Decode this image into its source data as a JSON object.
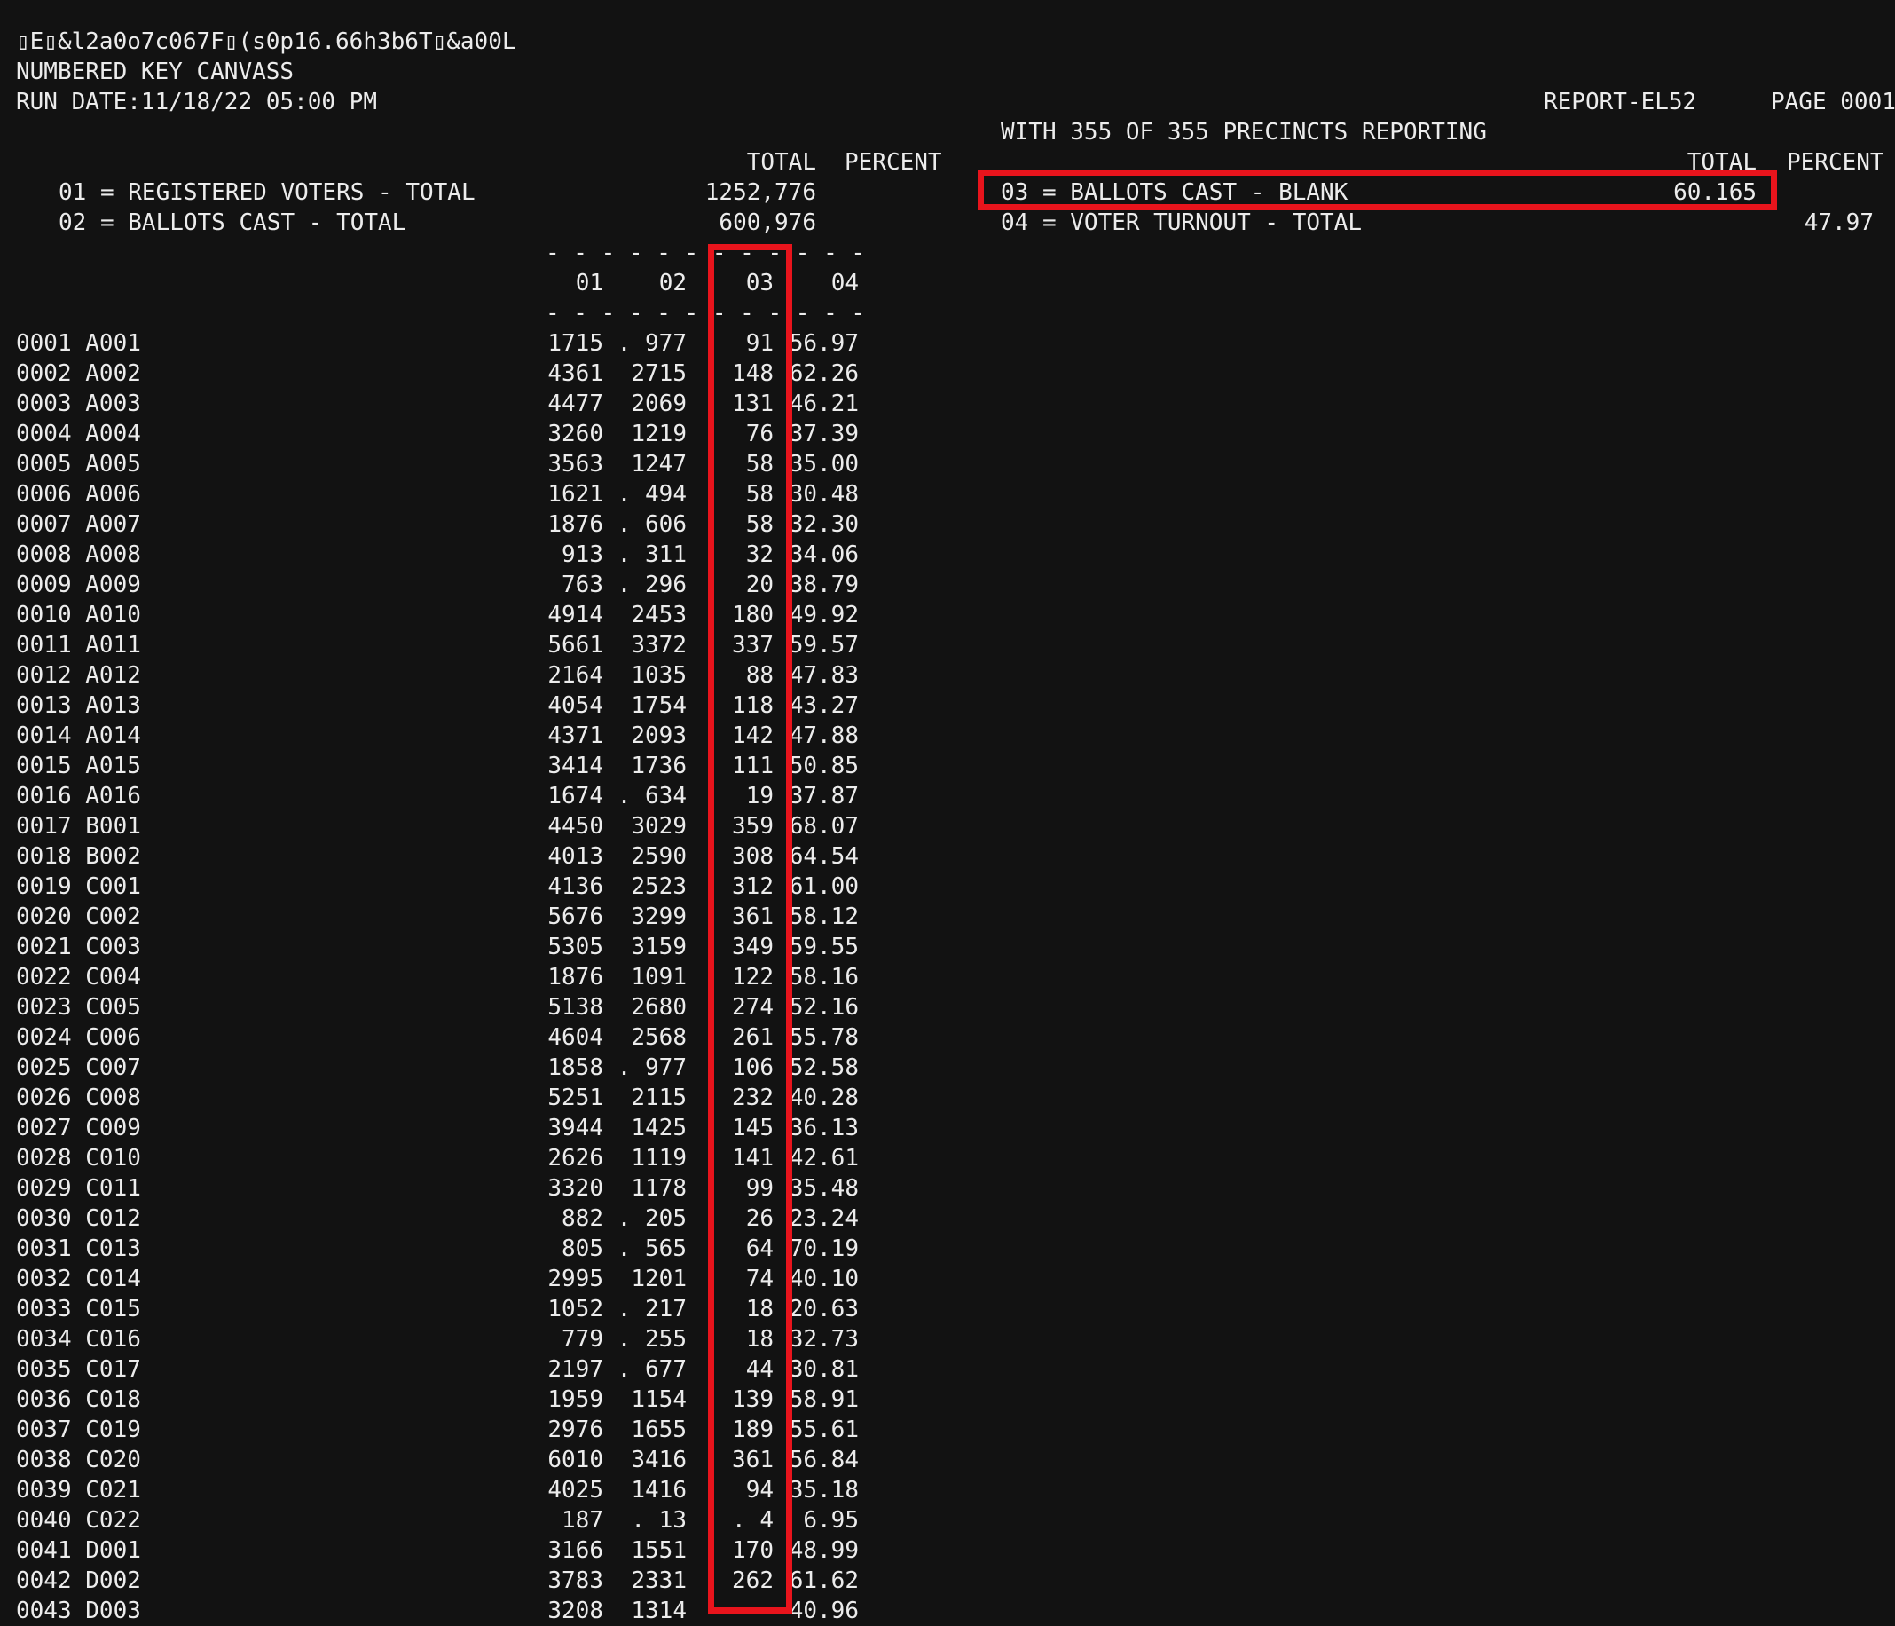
{
  "header": {
    "line1": "▯E▯&l2a0o7c067F▯(s0p16.66h3b6T▯&a00L",
    "title": "NUMBERED KEY CANVASS",
    "run_date": "RUN DATE:11/18/22 05:00 PM",
    "report_id": "REPORT-EL52",
    "page": "PAGE 0001",
    "precincts": "WITH 355 OF 355 PRECINCTS REPORTING"
  },
  "summary": {
    "total_header": "TOTAL",
    "percent_header": "PERCENT",
    "items": [
      {
        "label": "01 = REGISTERED VOTERS - TOTAL",
        "total": "1252,776",
        "percent": ""
      },
      {
        "label": "02 = BALLOTS CAST - TOTAL",
        "total": "600,976",
        "percent": ""
      },
      {
        "label": "03 = BALLOTS CAST - BLANK",
        "total": "60.165",
        "percent": ""
      },
      {
        "label": "04 = VOTER TURNOUT - TOTAL",
        "total": "",
        "percent": "47.97"
      }
    ]
  },
  "table": {
    "dash_line": "- - - - - - - - - - - -",
    "columns": [
      "01",
      "02",
      "03",
      "04"
    ],
    "rows": [
      [
        "0001 A001",
        "1715",
        ". 977",
        "91",
        "56.97"
      ],
      [
        "0002 A002",
        "4361",
        "2715",
        "148",
        "62.26"
      ],
      [
        "0003 A003",
        "4477",
        "2069",
        "131",
        "46.21"
      ],
      [
        "0004 A004",
        "3260",
        "1219",
        "76",
        "37.39"
      ],
      [
        "0005 A005",
        "3563",
        "1247",
        "58",
        "35.00"
      ],
      [
        "0006 A006",
        "1621",
        ". 494",
        "58",
        "30.48"
      ],
      [
        "0007 A007",
        "1876",
        ". 606",
        "58",
        "32.30"
      ],
      [
        "0008 A008",
        "913",
        ". 311",
        "32",
        "34.06"
      ],
      [
        "0009 A009",
        "763",
        ". 296",
        "20",
        "38.79"
      ],
      [
        "0010 A010",
        "4914",
        "2453",
        "180",
        "49.92"
      ],
      [
        "0011 A011",
        "5661",
        "3372",
        "337",
        "59.57"
      ],
      [
        "0012 A012",
        "2164",
        "1035",
        "88",
        "47.83"
      ],
      [
        "0013 A013",
        "4054",
        "1754",
        "118",
        "43.27"
      ],
      [
        "0014 A014",
        "4371",
        "2093",
        "142",
        "47.88"
      ],
      [
        "0015 A015",
        "3414",
        "1736",
        "111",
        "50.85"
      ],
      [
        "0016 A016",
        "1674",
        ". 634",
        "19",
        "37.87"
      ],
      [
        "0017 B001",
        "4450",
        "3029",
        "359",
        "68.07"
      ],
      [
        "0018 B002",
        "4013",
        "2590",
        "308",
        "64.54"
      ],
      [
        "0019 C001",
        "4136",
        "2523",
        "312",
        "61.00"
      ],
      [
        "0020 C002",
        "5676",
        "3299",
        "361",
        "58.12"
      ],
      [
        "0021 C003",
        "5305",
        "3159",
        "349",
        "59.55"
      ],
      [
        "0022 C004",
        "1876",
        "1091",
        "122",
        "58.16"
      ],
      [
        "0023 C005",
        "5138",
        "2680",
        "274",
        "52.16"
      ],
      [
        "0024 C006",
        "4604",
        "2568",
        "261",
        "55.78"
      ],
      [
        "0025 C007",
        "1858",
        ". 977",
        "106",
        "52.58"
      ],
      [
        "0026 C008",
        "5251",
        "2115",
        "232",
        "40.28"
      ],
      [
        "0027 C009",
        "3944",
        "1425",
        "145",
        "36.13"
      ],
      [
        "0028 C010",
        "2626",
        "1119",
        "141",
        "42.61"
      ],
      [
        "0029 C011",
        "3320",
        "1178",
        "99",
        "35.48"
      ],
      [
        "0030 C012",
        "882",
        ". 205",
        "26",
        "23.24"
      ],
      [
        "0031 C013",
        "805",
        ". 565",
        "64",
        "70.19"
      ],
      [
        "0032 C014",
        "2995",
        "1201",
        "74",
        "40.10"
      ],
      [
        "0033 C015",
        "1052",
        ". 217",
        "18",
        "20.63"
      ],
      [
        "0034 C016",
        "779",
        ". 255",
        "18",
        "32.73"
      ],
      [
        "0035 C017",
        "2197",
        ". 677",
        "44",
        "30.81"
      ],
      [
        "0036 C018",
        "1959",
        "1154",
        "139",
        "58.91"
      ],
      [
        "0037 C019",
        "2976",
        "1655",
        "189",
        "55.61"
      ],
      [
        "0038 C020",
        "6010",
        "3416",
        "361",
        "56.84"
      ],
      [
        "0039 C021",
        "4025",
        "1416",
        "94",
        "35.18"
      ],
      [
        "0040 C022",
        "187",
        ". 13",
        ". 4",
        "6.95"
      ],
      [
        "0041 D001",
        "3166",
        "1551",
        "170",
        "48.99"
      ],
      [
        "0042 D002",
        "3783",
        "2331",
        "262",
        "61.62"
      ],
      [
        "0043 D003",
        "3208",
        "1314",
        "",
        "40.96"
      ]
    ]
  },
  "colors": {
    "background": "#121212",
    "text": "#ececec",
    "highlight": "#e8141c"
  }
}
